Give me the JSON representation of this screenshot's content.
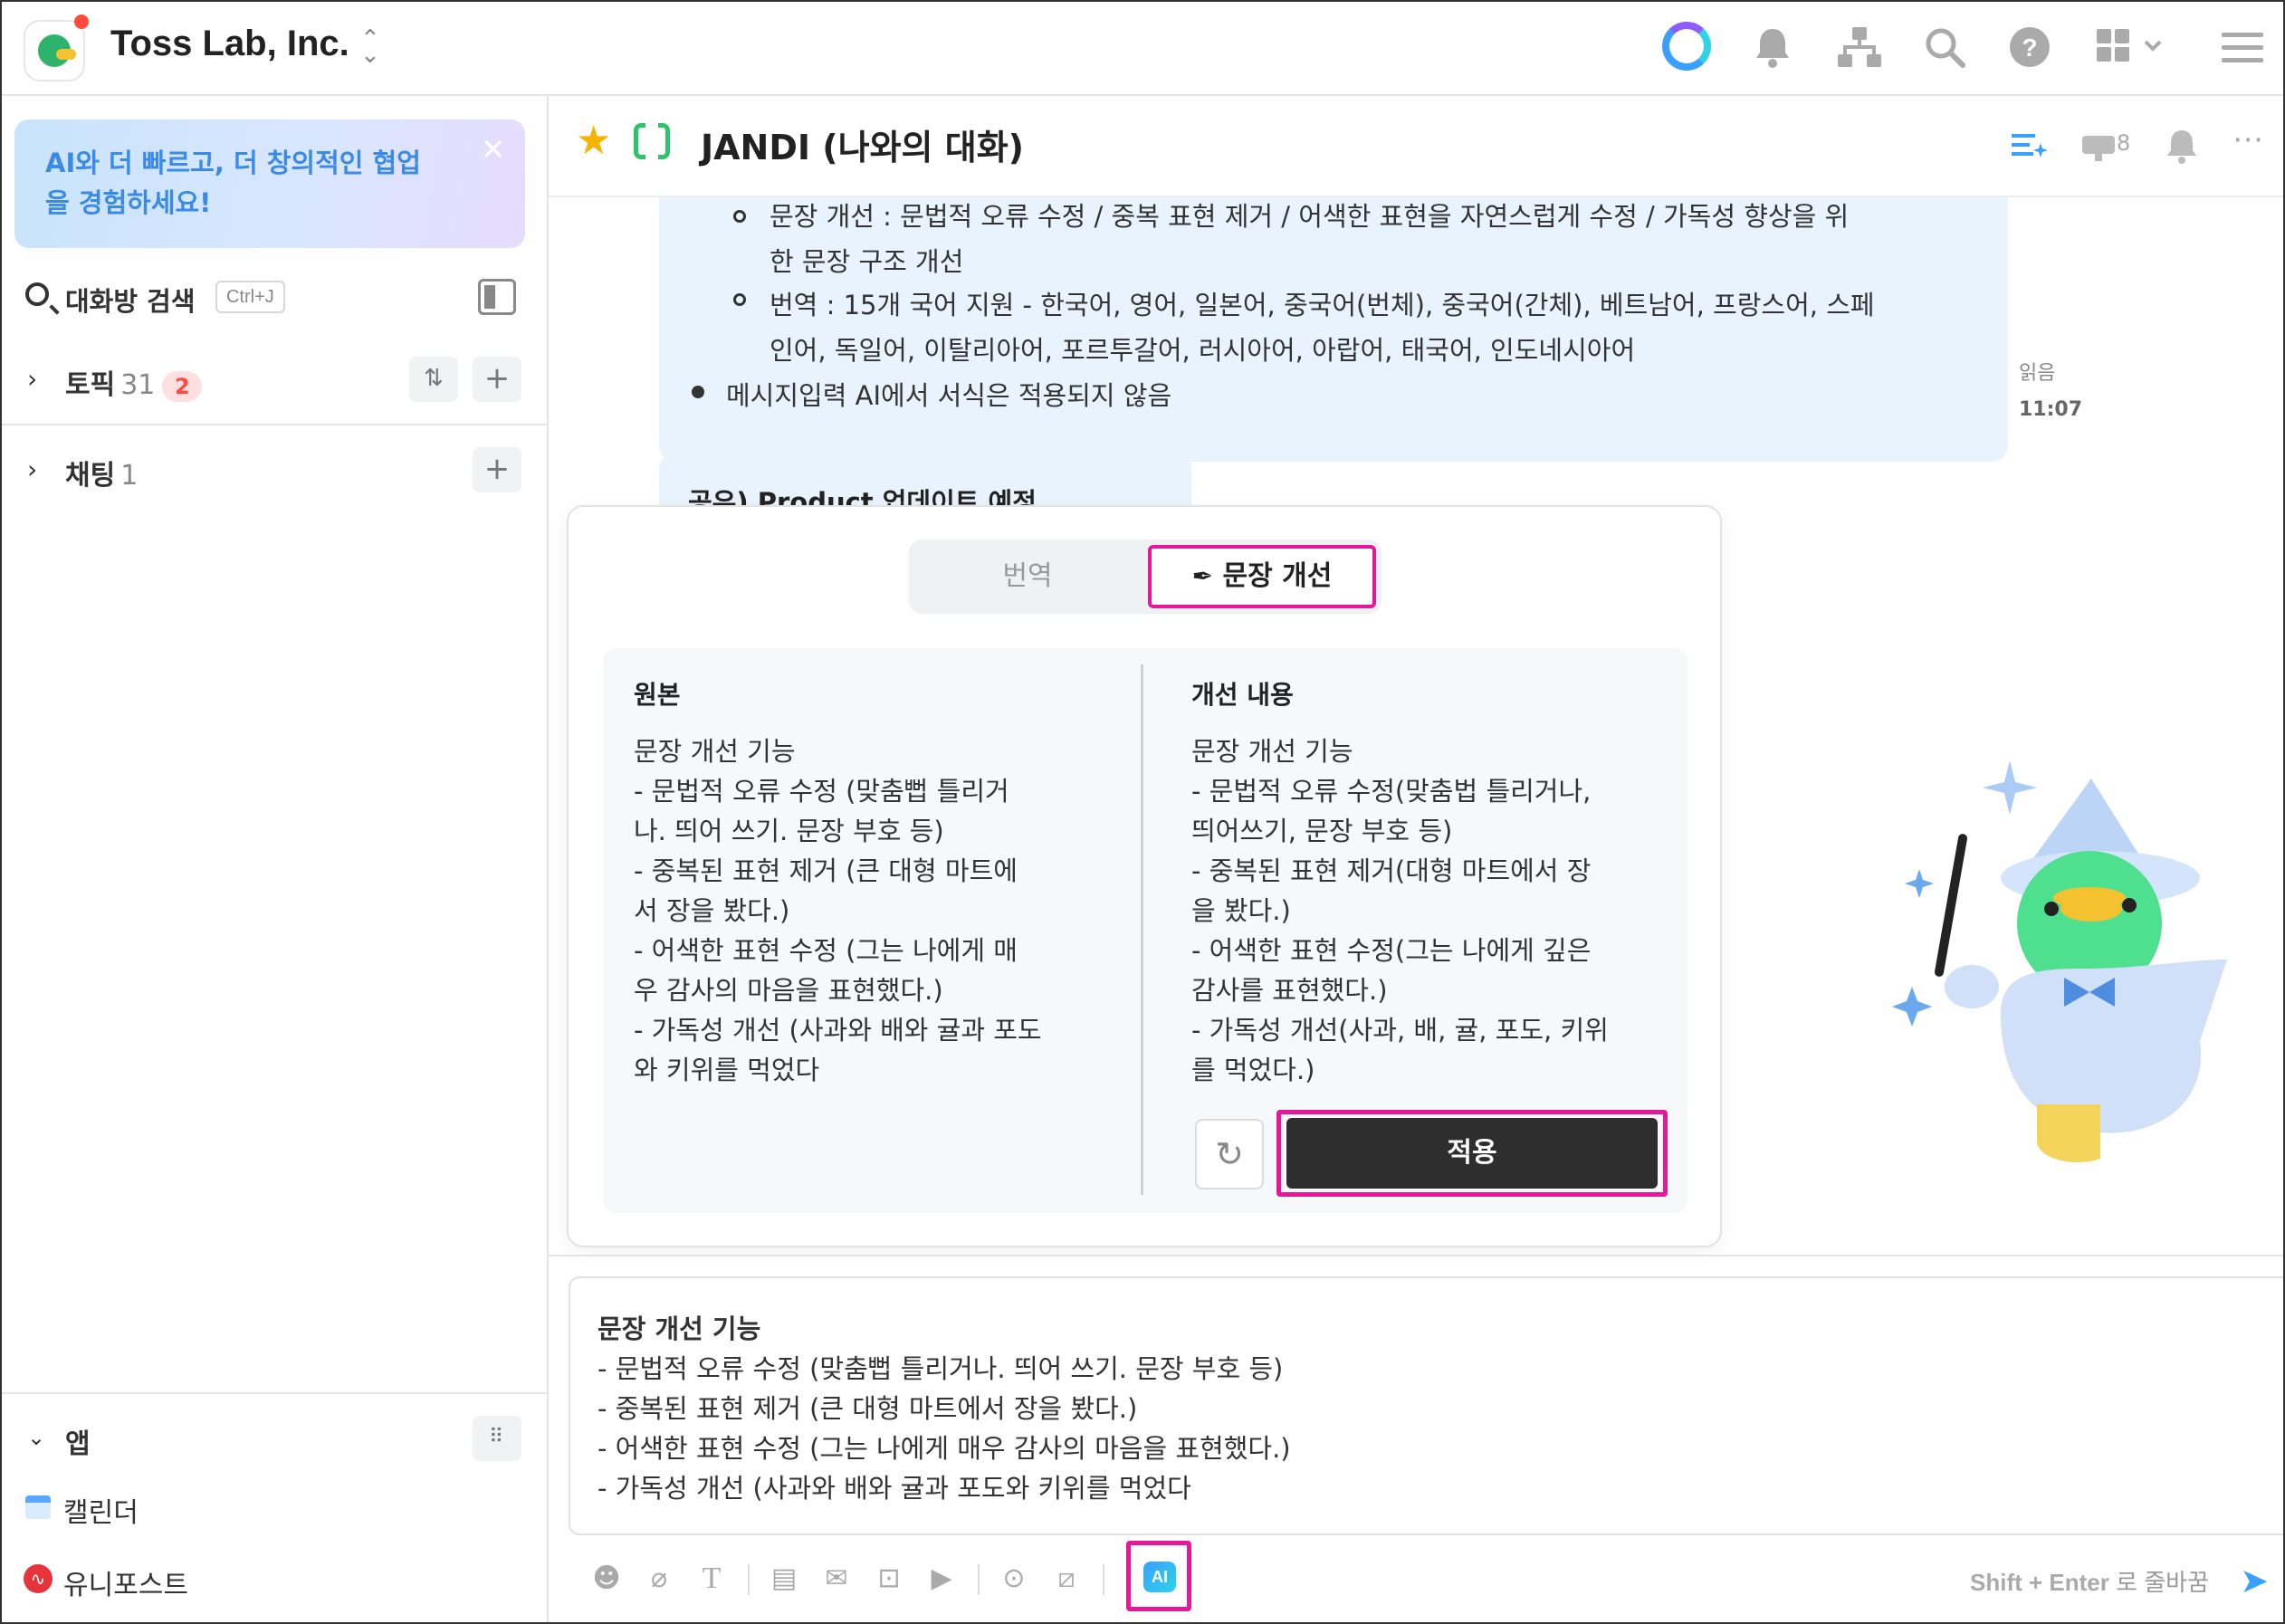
{
  "topbar": {
    "company": "Toss Lab, Inc.",
    "icons": [
      "ai-ring-icon",
      "bell-icon",
      "org-chart-icon",
      "search-icon",
      "help-icon",
      "grid-apps-icon",
      "menu-icon"
    ]
  },
  "sidebar": {
    "banner_text": "AI와 더 빠르고, 더 창의적인 협업을 경험하세요!",
    "search_label": "대화방 검색",
    "search_shortcut": "Ctrl+J",
    "topics": {
      "label": "토픽",
      "count": "31",
      "unread": "2"
    },
    "chats": {
      "label": "채팅",
      "count": "1"
    },
    "apps": {
      "label": "앱",
      "items": [
        "캘린더",
        "유니포스트"
      ]
    }
  },
  "chat": {
    "title": "JANDI (나와의 대화)",
    "pin_count": "8",
    "message_lines": [
      "문장 개선 : 문법적 오류 수정 / 중복 표현 제거 / 어색한 표현을 자연스럽게 수정 / 가독성 향상을 위",
      "한 문장 구조 개선",
      "번역 : 15개 국어 지원 - 한국어, 영어, 일본어, 중국어(번체), 중국어(간체), 베트남어, 프랑스어, 스페",
      "인어, 독일어, 이탈리아어, 포르투갈어, 러시아어, 아랍어, 태국어, 인도네시아어",
      "메시지입력 AI에서 서식은 적용되지 않음"
    ],
    "read_label": "읽음",
    "time": "11:07",
    "next_message": "공유) Product 업데이트 예정"
  },
  "ai_popup": {
    "tab_translate": "번역",
    "tab_improve": "문장 개선",
    "original_title": "원본",
    "original_body": "문장 개선 기능\n- 문법적 오류 수정 (맞춤뻡 틀리거\n나. 띄어 쓰기. 문장 부호 등)\n- 중복된 표현 제거 (큰 대형 마트에\n서 장을 봤다.)\n- 어색한 표현 수정 (그는 나에게 매\n우 감사의 마음을 표현했다.)\n- 가독성 개선 (사과와 배와 귤과 포도\n와 키위를 먹었다",
    "improved_title": "개선 내용",
    "improved_body": "문장 개선 기능\n- 문법적 오류 수정(맞춤법 틀리거나,\n띄어쓰기, 문장 부호 등)\n- 중복된 표현 제거(대형 마트에서 장\n을 봤다.)\n- 어색한 표현 수정(그는 나에게 깊은\n감사를 표현했다.)\n- 가독성 개선(사과, 배, 귤, 포도, 키위\n를 먹었다.)",
    "apply_label": "적용"
  },
  "composer": {
    "text_first": "문장 개선 기능",
    "text_rest": "- 문법적 오류 수정 (맞춤뻡 틀리거나. 띄어 쓰기. 문장 부호 등)\n- 중복된 표현 제거 (큰 대형 마트에서 장을 봤다.)\n- 어색한 표현 수정 (그는 나에게 매우 감사의 마음을 표현했다.)\n- 가독성 개선 (사과와 배와 귤과 포도와 키위를 먹었다",
    "ai_label": "AI",
    "hint_key": "Shift + Enter",
    "hint_text": "로 줄바꿈"
  },
  "colors": {
    "highlight": "#e5179b",
    "bubble": "#e8f3fd",
    "accent": "#3aa0ff",
    "apply_bg": "#2e2e2e"
  }
}
